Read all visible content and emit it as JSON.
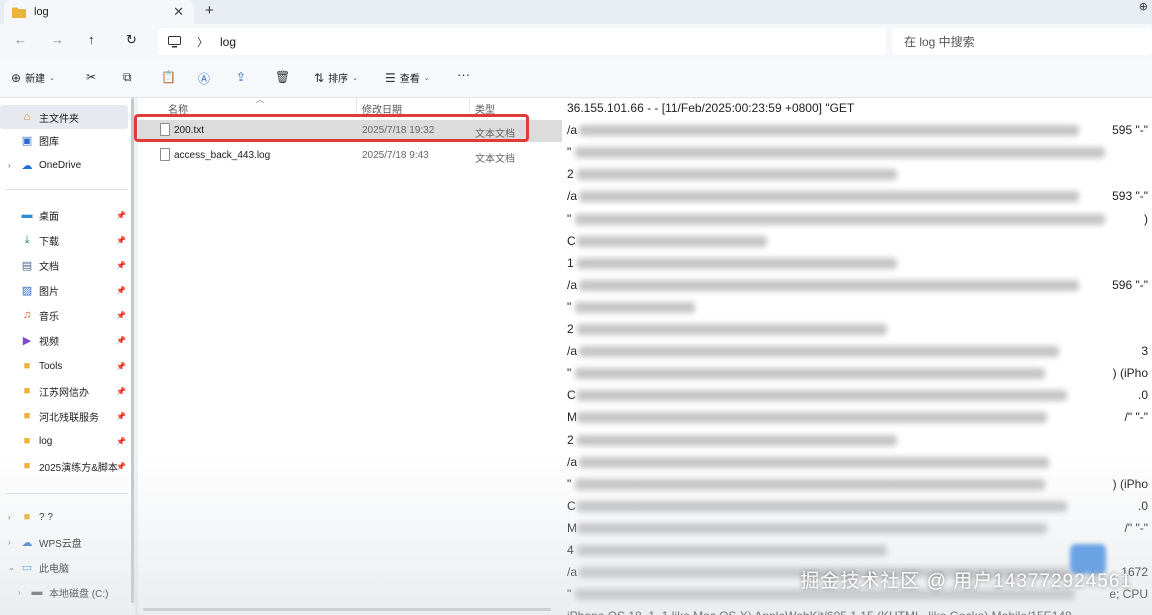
{
  "window": {
    "tab_title": "log",
    "tab_close": "✕",
    "new_tab": "+",
    "controls": "⊕"
  },
  "addressbar": {
    "path_label": "log",
    "search_placeholder": "在 log 中搜索"
  },
  "toolbar": {
    "new_label": "新建",
    "sort_label": "排序",
    "view_label": "查看",
    "more_label": "···"
  },
  "sidebar": {
    "home": "主文件夹",
    "gallery": "图库",
    "onedrive": "OneDrive",
    "quick": [
      {
        "label": "桌面",
        "icon": "desktop-icon"
      },
      {
        "label": "下载",
        "icon": "download-icon"
      },
      {
        "label": "文档",
        "icon": "document-icon"
      },
      {
        "label": "图片",
        "icon": "picture-icon"
      },
      {
        "label": "音乐",
        "icon": "music-icon"
      },
      {
        "label": "视频",
        "icon": "video-icon"
      },
      {
        "label": "Tools",
        "icon": "folder-icon"
      },
      {
        "label": "江苏网信办",
        "icon": "folder-icon"
      },
      {
        "label": "河北残联服务",
        "icon": "folder-icon"
      },
      {
        "label": "log",
        "icon": "folder-icon"
      },
      {
        "label": "2025演练方&脚本",
        "icon": "folder-icon"
      }
    ],
    "drives": {
      "unknown": "? ?",
      "wps": "WPS云盘",
      "thispc": "此电脑",
      "local_c": "本地磁盘 (C:)"
    }
  },
  "filelist": {
    "columns": {
      "name": "名称",
      "date": "修改日期",
      "type": "类型"
    },
    "files": [
      {
        "name": "200.txt",
        "date": "2025/7/18 19:32",
        "type": "文本文档"
      },
      {
        "name": "access_back_443.log",
        "date": "2025/7/18 9:43",
        "type": "文本文档"
      }
    ]
  },
  "preview": {
    "lines": [
      {
        "lead": "36.155.101.66 - - [11/Feb/2025:00:23:59 +0800] \"GET",
        "trail": ""
      },
      {
        "lead": "/a",
        "trail": "595 \"-\""
      },
      {
        "lead": "\"",
        "trail": ""
      },
      {
        "lead": "2",
        "trail": ""
      },
      {
        "lead": "/a",
        "trail": "593 \"-\""
      },
      {
        "lead": "\"",
        "trail": ")"
      },
      {
        "lead": "C",
        "trail": ""
      },
      {
        "lead": "1",
        "trail": ""
      },
      {
        "lead": "/a",
        "trail": "596 \"-\""
      },
      {
        "lead": "\"",
        "trail": ""
      },
      {
        "lead": "2",
        "trail": ""
      },
      {
        "lead": "/a",
        "trail": "3"
      },
      {
        "lead": "\"",
        "trail": ") (iPho"
      },
      {
        "lead": "C",
        "trail": ".0"
      },
      {
        "lead": "M",
        "trail": "/\" \"-\""
      },
      {
        "lead": "2",
        "trail": ""
      },
      {
        "lead": "/a",
        "trail": ""
      },
      {
        "lead": "\"",
        "trail": ") (iPho"
      },
      {
        "lead": "C",
        "trail": ".0"
      },
      {
        "lead": "M",
        "trail": "/\" \"-\""
      },
      {
        "lead": "4",
        "trail": ""
      },
      {
        "lead": "/a",
        "trail": "1672"
      },
      {
        "lead": "\"",
        "trail": "e; CPU"
      },
      {
        "lead": "iPhone OS 18_1_1 like Mac OS X) AppleWebKit/605.1.15 (KHTML, like Gecko) Mobile/15E148",
        "trail": ""
      }
    ]
  },
  "watermark": "掘金技术社区 @ 用户143772924561",
  "colors": {
    "highlight": "#e03b3b",
    "selected_row": "#dcdcdc",
    "folder": "#e8b43a",
    "accent": "#2c6cc9"
  }
}
